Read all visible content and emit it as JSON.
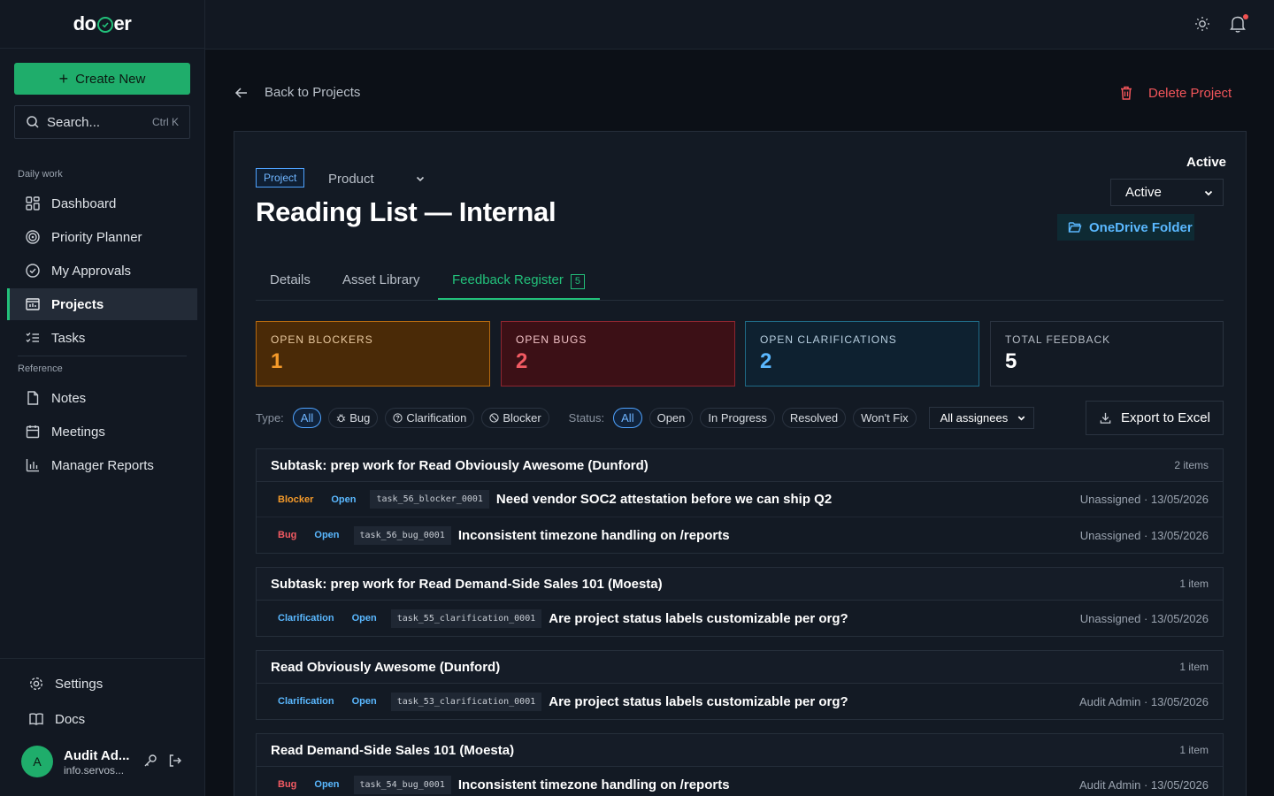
{
  "brand": {
    "prefix": "do",
    "suffix": "er"
  },
  "sidebar": {
    "create_label": "Create New",
    "search_placeholder": "Search...",
    "search_shortcut": "Ctrl K",
    "section_daily": "Daily work",
    "section_reference": "Reference",
    "daily_items": [
      {
        "label": "Dashboard",
        "icon": "grid-icon"
      },
      {
        "label": "Priority Planner",
        "icon": "target-icon"
      },
      {
        "label": "My Approvals",
        "icon": "check-circle-icon"
      },
      {
        "label": "Projects",
        "icon": "folder-chart-icon",
        "active": true
      },
      {
        "label": "Tasks",
        "icon": "checklist-icon"
      }
    ],
    "reference_items": [
      {
        "label": "Notes",
        "icon": "file-icon"
      },
      {
        "label": "Meetings",
        "icon": "calendar-icon"
      },
      {
        "label": "Manager Reports",
        "icon": "bar-chart-icon"
      }
    ],
    "settings_label": "Settings",
    "docs_label": "Docs",
    "user": {
      "initial": "A",
      "name": "Audit Ad...",
      "email": "info.servos..."
    }
  },
  "topbar": {
    "theme_icon": "sun-icon",
    "notifications_icon": "bell-icon"
  },
  "header": {
    "back_label": "Back to Projects",
    "delete_label": "Delete Project"
  },
  "project": {
    "badge": "Project",
    "category": "Product",
    "title": "Reading List — Internal",
    "status_label": "Active",
    "status_value": "Active",
    "folder_label": "OneDrive Folder"
  },
  "tabs": [
    {
      "label": "Details"
    },
    {
      "label": "Asset Library"
    },
    {
      "label": "Feedback Register",
      "count": "5",
      "active": true
    }
  ],
  "stats": {
    "blockers": {
      "label": "OPEN BLOCKERS",
      "value": "1"
    },
    "bugs": {
      "label": "OPEN BUGS",
      "value": "2"
    },
    "clarifications": {
      "label": "OPEN CLARIFICATIONS",
      "value": "2"
    },
    "total": {
      "label": "TOTAL FEEDBACK",
      "value": "5"
    }
  },
  "filters": {
    "type_label": "Type:",
    "type_options": [
      "All",
      "Bug",
      "Clarification",
      "Blocker"
    ],
    "status_label": "Status:",
    "status_options": [
      "All",
      "Open",
      "In Progress",
      "Resolved",
      "Won't Fix"
    ],
    "assignee": "All assignees",
    "export_label": "Export to Excel"
  },
  "groups": [
    {
      "title": "Subtask: prep work for Read Obviously Awesome (Dunford)",
      "count": "2 items",
      "rows": [
        {
          "type": "Blocker",
          "status": "Open",
          "id": "task_56_blocker_0001",
          "title": "Need vendor SOC2 attestation before we can ship Q2",
          "meta": "Unassigned · 13/05/2026"
        },
        {
          "type": "Bug",
          "status": "Open",
          "id": "task_56_bug_0001",
          "title": "Inconsistent timezone handling on /reports",
          "meta": "Unassigned · 13/05/2026"
        }
      ]
    },
    {
      "title": "Subtask: prep work for Read Demand-Side Sales 101 (Moesta)",
      "count": "1 item",
      "rows": [
        {
          "type": "Clarification",
          "status": "Open",
          "id": "task_55_clarification_0001",
          "title": "Are project status labels customizable per org?",
          "meta": "Unassigned · 13/05/2026"
        }
      ]
    },
    {
      "title": "Read Obviously Awesome (Dunford)",
      "count": "1 item",
      "rows": [
        {
          "type": "Clarification",
          "status": "Open",
          "id": "task_53_clarification_0001",
          "title": "Are project status labels customizable per org?",
          "meta": "Audit Admin · 13/05/2026"
        }
      ]
    },
    {
      "title": "Read Demand-Side Sales 101 (Moesta)",
      "count": "1 item",
      "rows": [
        {
          "type": "Bug",
          "status": "Open",
          "id": "task_54_bug_0001",
          "title": "Inconsistent timezone handling on /reports",
          "meta": "Audit Admin · 13/05/2026"
        }
      ]
    }
  ],
  "colors": {
    "accent": "#22c07a",
    "blocker": "#f59a2a",
    "bug": "#f25a62",
    "clarification": "#5ab8ff",
    "danger": "#f2555a"
  }
}
